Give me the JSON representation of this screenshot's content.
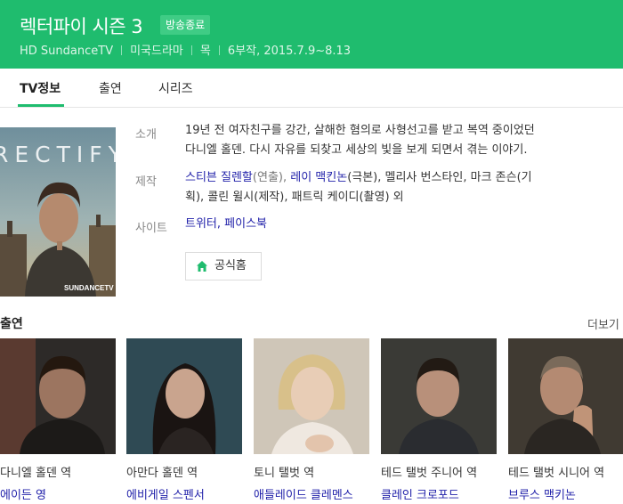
{
  "header": {
    "title": "렉터파이 시즌 3",
    "badge": "방송종료",
    "channel": "HD SundanceTV",
    "genre": "미국드라마",
    "day": "목",
    "episodes": "6부작, 2015.7.9~8.13"
  },
  "tabs": [
    "TV정보",
    "출연",
    "시리즈"
  ],
  "poster": {
    "title_text": "RECTIFY",
    "logo_text": "SUNDANCETV"
  },
  "info": {
    "summary_label": "소개",
    "summary_line1": "19년 전 여자친구를 강간, 살해한 혐의로 사형선고를 받고 복역 중이었던",
    "summary_line2": "다니엘 홀덴. 다시 자유를 되찾고 세상의 빛을 보게 되면서 겪는 이야기.",
    "production_label": "제작",
    "prod_link1": "스티븐 질렌할",
    "prod_role1": "(연출), ",
    "prod_link2": "레이 맥킨논",
    "prod_role2": "(극본), 멜리사 번스타인, 마크 존슨(기",
    "prod_line2": "획), 콜린 윌시(제작), 패트릭 케이디(촬영) 외",
    "site_label": "사이트",
    "site_link1": "트위터",
    "site_comma": ", ",
    "site_link2": "페이스북",
    "home_button": "공식홈"
  },
  "cast": {
    "title": "출연",
    "more": "더보기",
    "members": [
      {
        "role": "다니엘 홀덴 역",
        "name": "에이든 영"
      },
      {
        "role": "아만다 홀덴 역",
        "name": "에비게일 스펜서"
      },
      {
        "role": "토니 탤벗 역",
        "name": "애들레이드 클레멘스"
      },
      {
        "role": "테드 탤벗 주니어 역",
        "name": "클레인 크로포드"
      },
      {
        "role": "테드 탤벗 시니어 역",
        "name": "브루스 맥키논"
      }
    ]
  },
  "colors": {
    "brand": "#1fbc6e",
    "link": "#2222aa"
  }
}
